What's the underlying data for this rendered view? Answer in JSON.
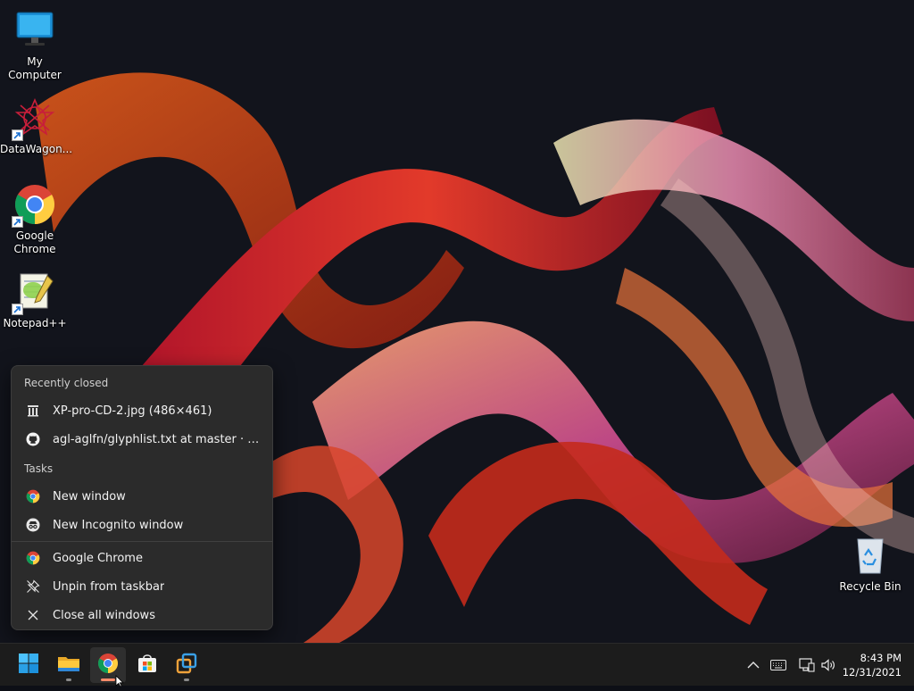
{
  "desktop": {
    "icons": [
      {
        "label": "My Computer"
      },
      {
        "label": "DataWagon..."
      },
      {
        "label": "Google Chrome"
      },
      {
        "label": "Notepad++"
      },
      {
        "label": "Recycle Bin"
      }
    ]
  },
  "jumplist": {
    "recently_closed_header": "Recently closed",
    "recent": [
      {
        "label": "XP-pro-CD-2.jpg (486×461)",
        "icon": "image-file-icon"
      },
      {
        "label": "agl-aglfn/glyphlist.txt at master · ad...",
        "icon": "github-icon"
      }
    ],
    "tasks_header": "Tasks",
    "tasks": [
      {
        "label": "New window",
        "icon": "chrome-icon"
      },
      {
        "label": "New Incognito window",
        "icon": "incognito-icon"
      }
    ],
    "actions": [
      {
        "label": "Google Chrome",
        "icon": "chrome-icon"
      },
      {
        "label": "Unpin from taskbar",
        "icon": "unpin-icon"
      },
      {
        "label": "Close all windows",
        "icon": "close-icon"
      }
    ]
  },
  "taskbar": {
    "apps": [
      "start-icon",
      "file-explorer-icon",
      "chrome-icon",
      "store-icon",
      "vmware-icon"
    ],
    "active_app": "chrome-icon",
    "accent_color": "#ff8b6a",
    "clock": {
      "time": "8:43 PM",
      "date": "12/31/2021"
    }
  }
}
